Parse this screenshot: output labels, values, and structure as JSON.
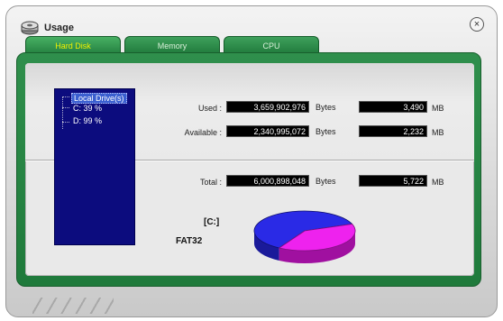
{
  "window": {
    "title": "Usage",
    "close_symbol": "×",
    "app_icon": "drive-icon"
  },
  "tabs": [
    {
      "label": "Hard Disk",
      "active": true
    },
    {
      "label": "Memory",
      "active": false
    },
    {
      "label": "CPU",
      "active": false
    }
  ],
  "tree": {
    "root": "Local Drive(s)",
    "items": [
      "C:  39 %",
      "D:  99 %"
    ]
  },
  "stats": {
    "used_label": "Used :",
    "used_bytes": "3,659,902,976",
    "used_mb": "3,490",
    "available_label": "Available :",
    "available_bytes": "2,340,995,072",
    "available_mb": "2,232",
    "total_label": "Total :",
    "total_bytes": "6,000,898,048",
    "total_mb": "5,722",
    "bytes_unit": "Bytes",
    "mb_unit": "MB"
  },
  "drive": {
    "letter": "[C:]",
    "filesystem": "FAT32",
    "used_fraction": 0.61,
    "available_fraction": 0.39
  },
  "colors": {
    "used": "#2a2ae6",
    "available": "#ee22ee",
    "frame_green": "#2f8f4c",
    "active_tab_text": "#f0f000",
    "tree_bg": "#0c0c7e"
  }
}
